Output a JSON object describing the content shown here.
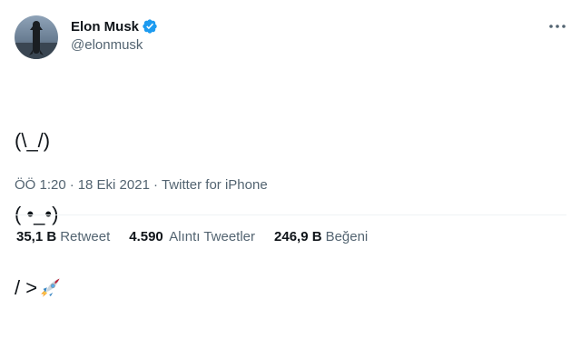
{
  "author": {
    "display_name": "Elon Musk",
    "handle": "@elonmusk",
    "verified_icon": "verified-badge-icon",
    "avatar_icon": "starship-avatar"
  },
  "tweet": {
    "line1": "(\\_/)",
    "line2": "( •_•)",
    "line3": "/ >",
    "emoji_icon": "rocket-emoji-icon"
  },
  "meta": {
    "time": "ÖÖ 1:20",
    "separator1": "·",
    "date": "18 Eki 2021",
    "separator2": "·",
    "source": "Twitter for iPhone"
  },
  "stats": {
    "retweets_count": "35,1 B",
    "retweets_label": "Retweet",
    "quotes_count": "4.590",
    "quotes_label": "Alıntı Tweetler",
    "likes_count": "246,9 B",
    "likes_label": "Beğeni"
  },
  "colors": {
    "text_primary": "#0f1419",
    "text_secondary": "#536471",
    "verified_blue": "#1d9bf0",
    "divider": "#eff3f4"
  }
}
